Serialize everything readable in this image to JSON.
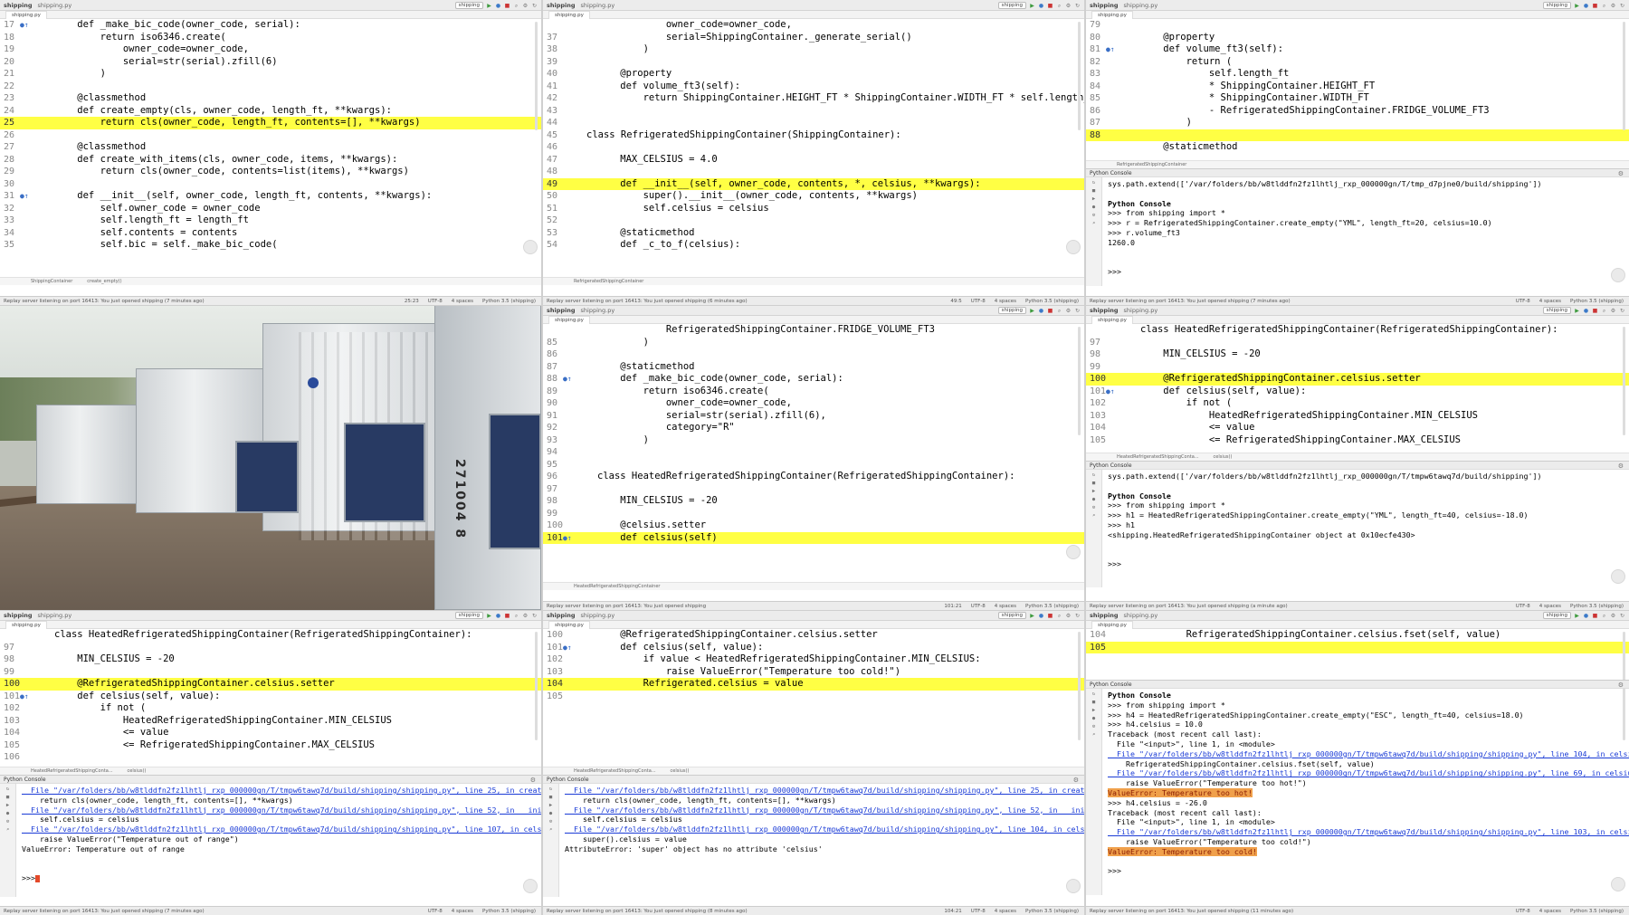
{
  "common": {
    "project": "shipping",
    "file_tab": "shipping.py",
    "run_config": "shipping",
    "console_title": "Python Console",
    "encoding": "UTF-8",
    "indent": "4 spaces",
    "interpreter": "Python 3.5 (shipping)"
  },
  "panel0": {
    "breadcrumb": [
      "ShippingContainer",
      "create_empty()"
    ],
    "status_left": "Replay server listening on port 16413: You just opened shipping (7 minutes ago)",
    "status_pos": "25:23",
    "lines": [
      {
        "n": "17",
        "t": "    def _make_bic_code(owner_code, serial):",
        "hl": false,
        "mk": true
      },
      {
        "n": "18",
        "t": "        return iso6346.create(",
        "hl": false
      },
      {
        "n": "19",
        "t": "            owner_code=owner_code,",
        "hl": false
      },
      {
        "n": "20",
        "t": "            serial=str(serial).zfill(6)",
        "hl": false
      },
      {
        "n": "21",
        "t": "        )",
        "hl": false
      },
      {
        "n": "22",
        "t": "",
        "hl": false
      },
      {
        "n": "23",
        "t": "    @classmethod",
        "hl": false
      },
      {
        "n": "24",
        "t": "    def create_empty(cls, owner_code, length_ft, **kwargs):",
        "hl": false
      },
      {
        "n": "25",
        "t": "        return cls(owner_code, length_ft, contents=[], **kwargs)",
        "hl": true
      },
      {
        "n": "26",
        "t": "",
        "hl": false
      },
      {
        "n": "27",
        "t": "    @classmethod",
        "hl": false
      },
      {
        "n": "28",
        "t": "    def create_with_items(cls, owner_code, items, **kwargs):",
        "hl": false
      },
      {
        "n": "29",
        "t": "        return cls(owner_code, contents=list(items), **kwargs)",
        "hl": false
      },
      {
        "n": "30",
        "t": "",
        "hl": false
      },
      {
        "n": "31",
        "t": "    def __init__(self, owner_code, length_ft, contents, **kwargs):",
        "hl": false,
        "mk": true
      },
      {
        "n": "32",
        "t": "        self.owner_code = owner_code",
        "hl": false
      },
      {
        "n": "33",
        "t": "        self.length_ft = length_ft",
        "hl": false
      },
      {
        "n": "34",
        "t": "        self.contents = contents",
        "hl": false
      },
      {
        "n": "35",
        "t": "        self.bic = self._make_bic_code(",
        "hl": false
      }
    ]
  },
  "panel1": {
    "breadcrumb": [
      "RefrigeratedShippingContainer"
    ],
    "status_left": "Replay server listening on port 16413: You just opened shipping (6 minutes ago)",
    "status_pos": "49:5",
    "lines": [
      {
        "n": "",
        "t": "            owner_code=owner_code,",
        "hl": false
      },
      {
        "n": "37",
        "t": "            serial=ShippingContainer._generate_serial()",
        "hl": false
      },
      {
        "n": "38",
        "t": "        )",
        "hl": false
      },
      {
        "n": "39",
        "t": "",
        "hl": false
      },
      {
        "n": "40",
        "t": "    @property",
        "hl": false
      },
      {
        "n": "41",
        "t": "    def volume_ft3(self):",
        "hl": false
      },
      {
        "n": "42",
        "t": "        return ShippingContainer.HEIGHT_FT * ShippingContainer.WIDTH_FT * self.length_ft",
        "hl": false
      },
      {
        "n": "43",
        "t": "",
        "hl": false
      },
      {
        "n": "44",
        "t": "",
        "hl": false
      },
      {
        "n": "45",
        "t": "class RefrigeratedShippingContainer(ShippingContainer):",
        "hl": false,
        "indent": -2
      },
      {
        "n": "46",
        "t": "",
        "hl": false
      },
      {
        "n": "47",
        "t": "    MAX_CELSIUS = 4.0",
        "hl": false
      },
      {
        "n": "48",
        "t": "",
        "hl": false
      },
      {
        "n": "49",
        "t": "    def __init__(self, owner_code, contents, *, celsius, **kwargs):",
        "hl": true
      },
      {
        "n": "50",
        "t": "        super().__init__(owner_code, contents, **kwargs)",
        "hl": false
      },
      {
        "n": "51",
        "t": "        self.celsius = celsius",
        "hl": false
      },
      {
        "n": "52",
        "t": "",
        "hl": false
      },
      {
        "n": "53",
        "t": "    @staticmethod",
        "hl": false
      },
      {
        "n": "54",
        "t": "    def _c_to_f(celsius):",
        "hl": false
      }
    ]
  },
  "panel2": {
    "breadcrumb": [
      "RefrigeratedShippingContainer"
    ],
    "status_left": "Replay server listening on port 16413: You just opened shipping (7 minutes ago)",
    "lines": [
      {
        "n": "79",
        "t": "",
        "hl": false
      },
      {
        "n": "80",
        "t": "    @property",
        "hl": false
      },
      {
        "n": "81",
        "t": "    def volume_ft3(self):",
        "hl": false,
        "mk": true
      },
      {
        "n": "82",
        "t": "        return (",
        "hl": false
      },
      {
        "n": "83",
        "t": "            self.length_ft",
        "hl": false
      },
      {
        "n": "84",
        "t": "            * ShippingContainer.HEIGHT_FT",
        "hl": false
      },
      {
        "n": "85",
        "t": "            * ShippingContainer.WIDTH_FT",
        "hl": false
      },
      {
        "n": "86",
        "t": "            - RefrigeratedShippingContainer.FRIDGE_VOLUME_FT3",
        "hl": false
      },
      {
        "n": "87",
        "t": "        )",
        "hl": false
      },
      {
        "n": "88",
        "t": "",
        "hl": true
      },
      {
        "n": "",
        "t": "    @staticmethod",
        "hl": false
      }
    ],
    "console": [
      "sys.path.extend(['/var/folders/bb/w8tlddfn2fz1lhtlj_rxp_000000gn/T/tmp_d7pjne0/build/shipping'])",
      "",
      "Python Console",
      ">>> from shipping import *",
      ">>> r = RefrigeratedShippingContainer.create_empty(\"YML\", length_ft=20, celsius=10.0)",
      ">>> r.volume_ft3",
      "1260.0",
      "",
      "",
      ">>>"
    ]
  },
  "panel3": {
    "photo_serial": "271004 8"
  },
  "panel4": {
    "breadcrumb": [
      "HeatedRefrigeratedShippingContainer"
    ],
    "status_left": "Replay server listening on port 16413: You just opened shipping",
    "status_pos": "101:21",
    "lines": [
      {
        "n": "",
        "t": "            RefrigeratedShippingContainer.FRIDGE_VOLUME_FT3",
        "hl": false
      },
      {
        "n": "85",
        "t": "        )",
        "hl": false
      },
      {
        "n": "86",
        "t": "",
        "hl": false
      },
      {
        "n": "87",
        "t": "    @staticmethod",
        "hl": false
      },
      {
        "n": "88",
        "t": "    def _make_bic_code(owner_code, serial):",
        "hl": false,
        "mk": true
      },
      {
        "n": "89",
        "t": "        return iso6346.create(",
        "hl": false
      },
      {
        "n": "90",
        "t": "            owner_code=owner_code,",
        "hl": false
      },
      {
        "n": "91",
        "t": "            serial=str(serial).zfill(6),",
        "hl": false
      },
      {
        "n": "92",
        "t": "            category=\"R\"",
        "hl": false
      },
      {
        "n": "93",
        "t": "        )",
        "hl": false
      },
      {
        "n": "94",
        "t": "",
        "hl": false
      },
      {
        "n": "95",
        "t": "",
        "hl": false
      },
      {
        "n": "96",
        "t": "class HeatedRefrigeratedShippingContainer(RefrigeratedShippingContainer):",
        "hl": false
      },
      {
        "n": "97",
        "t": "",
        "hl": false
      },
      {
        "n": "98",
        "t": "    MIN_CELSIUS = -20",
        "hl": false
      },
      {
        "n": "99",
        "t": "",
        "hl": false
      },
      {
        "n": "100",
        "t": "    @celsius.setter",
        "hl": false
      },
      {
        "n": "101",
        "t": "    def celsius(self)",
        "hl": true,
        "mk": true
      }
    ]
  },
  "panel5": {
    "breadcrumb": [
      "HeatedRefrigeratedShippingConta...",
      "celsius()"
    ],
    "status_left": "Replay server listening on port 16413: You just opened shipping (a minute ago)",
    "lines": [
      {
        "n": "",
        "t": "class HeatedRefrigeratedShippingContainer(RefrigeratedShippingContainer):",
        "hl": false
      },
      {
        "n": "97",
        "t": "",
        "hl": false
      },
      {
        "n": "98",
        "t": "    MIN_CELSIUS = -20",
        "hl": false
      },
      {
        "n": "99",
        "t": "",
        "hl": false
      },
      {
        "n": "100",
        "t": "    @RefrigeratedShippingContainer.celsius.setter",
        "hl": true
      },
      {
        "n": "101",
        "t": "    def celsius(self, value):",
        "hl": false,
        "mk": true
      },
      {
        "n": "102",
        "t": "        if not (",
        "hl": false
      },
      {
        "n": "103",
        "t": "            HeatedRefrigeratedShippingContainer.MIN_CELSIUS",
        "hl": false
      },
      {
        "n": "104",
        "t": "            <= value",
        "hl": false
      },
      {
        "n": "105",
        "t": "            <= RefrigeratedShippingContainer.MAX_CELSIUS",
        "hl": false
      }
    ],
    "console": [
      "sys.path.extend(['/var/folders/bb/w8tlddfn2fz1lhtlj_rxp_000000gn/T/tmpw6tawq7d/build/shipping'])",
      "",
      "Python Console",
      ">>> from shipping import *",
      ">>> h1 = HeatedRefrigeratedShippingContainer.create_empty(\"YML\", length_ft=40, celsius=-18.0)",
      ">>> h1",
      "<shipping.HeatedRefrigeratedShippingContainer object at 0x10ecfe430>",
      "",
      "",
      ">>>"
    ]
  },
  "panel6": {
    "breadcrumb": [
      "HeatedRefrigeratedShippingConta...",
      "celsius()"
    ],
    "status_left": "Replay server listening on port 16413: You just opened shipping (7 minutes ago)",
    "lines": [
      {
        "n": "",
        "t": "class HeatedRefrigeratedShippingContainer(RefrigeratedShippingContainer):",
        "hl": false
      },
      {
        "n": "97",
        "t": "",
        "hl": false
      },
      {
        "n": "98",
        "t": "    MIN_CELSIUS = -20",
        "hl": false
      },
      {
        "n": "99",
        "t": "",
        "hl": false
      },
      {
        "n": "100",
        "t": "    @RefrigeratedShippingContainer.celsius.setter",
        "hl": true
      },
      {
        "n": "101",
        "t": "    def celsius(self, value):",
        "hl": false,
        "mk": true
      },
      {
        "n": "102",
        "t": "        if not (",
        "hl": false
      },
      {
        "n": "103",
        "t": "            HeatedRefrigeratedShippingContainer.MIN_CELSIUS",
        "hl": false
      },
      {
        "n": "104",
        "t": "            <= value",
        "hl": false
      },
      {
        "n": "105",
        "t": "            <= RefrigeratedShippingContainer.MAX_CELSIUS",
        "hl": false
      },
      {
        "n": "106",
        "t": "",
        "hl": false
      }
    ],
    "console": [
      "  File \"/var/folders/bb/w8tlddfn2fz1lhtlj_rxp_000000gn/T/tmpw6tawq7d/build/shipping/shipping.py\", line 25, in create_empt",
      "    return cls(owner_code, length_ft, contents=[], **kwargs)",
      "  File \"/var/folders/bb/w8tlddfn2fz1lhtlj_rxp_000000gn/T/tmpw6tawq7d/build/shipping/shipping.py\", line 52, in __init__",
      "    self.celsius = celsius",
      "  File \"/var/folders/bb/w8tlddfn2fz1lhtlj_rxp_000000gn/T/tmpw6tawq7d/build/shipping/shipping.py\", line 107, in celsius",
      "    raise ValueError(\"Temperature out of range\")",
      "ValueError: Temperature out of range",
      "",
      "",
      ">>>"
    ]
  },
  "panel7": {
    "breadcrumb": [
      "HeatedRefrigeratedShippingConta...",
      "celsius()"
    ],
    "status_left": "Replay server listening on port 16413: You just opened shipping (8 minutes ago)",
    "status_pos": "104:21",
    "lines": [
      {
        "n": "100",
        "t": "    @RefrigeratedShippingContainer.celsius.setter",
        "hl": false
      },
      {
        "n": "101",
        "t": "    def celsius(self, value):",
        "hl": false,
        "mk": true
      },
      {
        "n": "102",
        "t": "        if value < HeatedRefrigeratedShippingContainer.MIN_CELSIUS:",
        "hl": false
      },
      {
        "n": "103",
        "t": "            raise ValueError(\"Temperature too cold!\")",
        "hl": false
      },
      {
        "n": "104",
        "t": "        Refrigerated.celsius = value",
        "hl": true
      },
      {
        "n": "105",
        "t": "",
        "hl": false
      }
    ],
    "console": [
      "  File \"/var/folders/bb/w8tlddfn2fz1lhtlj_rxp_000000gn/T/tmpw6tawq7d/build/shipping/shipping.py\", line 25, in create_empt",
      "    return cls(owner_code, length_ft, contents=[], **kwargs)",
      "  File \"/var/folders/bb/w8tlddfn2fz1lhtlj_rxp_000000gn/T/tmpw6tawq7d/build/shipping/shipping.py\", line 52, in __init__",
      "    self.celsius = celsius",
      "  File \"/var/folders/bb/w8tlddfn2fz1lhtlj_rxp_000000gn/T/tmpw6tawq7d/build/shipping/shipping.py\", line 104, in celsius",
      "    super().celsius = value",
      "AttributeError: 'super' object has no attribute 'celsius'"
    ]
  },
  "panel8": {
    "status_left": "Replay server listening on port 16413: You just opened shipping (11 minutes ago)",
    "lines": [
      {
        "n": "104",
        "t": "        RefrigeratedShippingContainer.celsius.fset(self, value)",
        "hl": false
      },
      {
        "n": "105",
        "t": "",
        "hl": true
      }
    ],
    "console": [
      "Python Console",
      ">>> from shipping import *",
      ">>> h4 = HeatedRefrigeratedShippingContainer.create_empty(\"ESC\", length_ft=40, celsius=18.0)",
      ">>> h4.celsius = 10.0",
      "Traceback (most recent call last):",
      "  File \"<input>\", line 1, in <module>",
      "  File \"/var/folders/bb/w8tlddfn2fz1lhtlj_rxp_000000gn/T/tmpw6tawq7d/build/shipping/shipping.py\", line 104, in celsius",
      "    RefrigeratedShippingContainer.celsius.fset(self, value)",
      "  File \"/var/folders/bb/w8tlddfn2fz1lhtlj_rxp_000000gn/T/tmpw6tawq7d/build/shipping/shipping.py\", line 69, in celsius",
      "    raise ValueError(\"Temperature too hot!\")",
      "ValueError: Temperature too hot!",
      ">>> h4.celsius = -26.0",
      "Traceback (most recent call last):",
      "  File \"<input>\", line 1, in <module>",
      "  File \"/var/folders/bb/w8tlddfn2fz1lhtlj_rxp_000000gn/T/tmpw6tawq7d/build/shipping/shipping.py\", line 103, in celsius",
      "    raise ValueError(\"Temperature too cold!\")",
      "ValueError: Temperature too cold!",
      "",
      ">>>"
    ]
  },
  "icons": [
    "run-icon",
    "debug-icon",
    "stop-icon",
    "search-icon",
    "gear-icon",
    "rerun-icon"
  ],
  "colors": {
    "highlight": "#ffff44",
    "error_bg": "#f0a04b",
    "link": "#1a3bd6",
    "keyword": "#000080",
    "self": "#94558d"
  }
}
